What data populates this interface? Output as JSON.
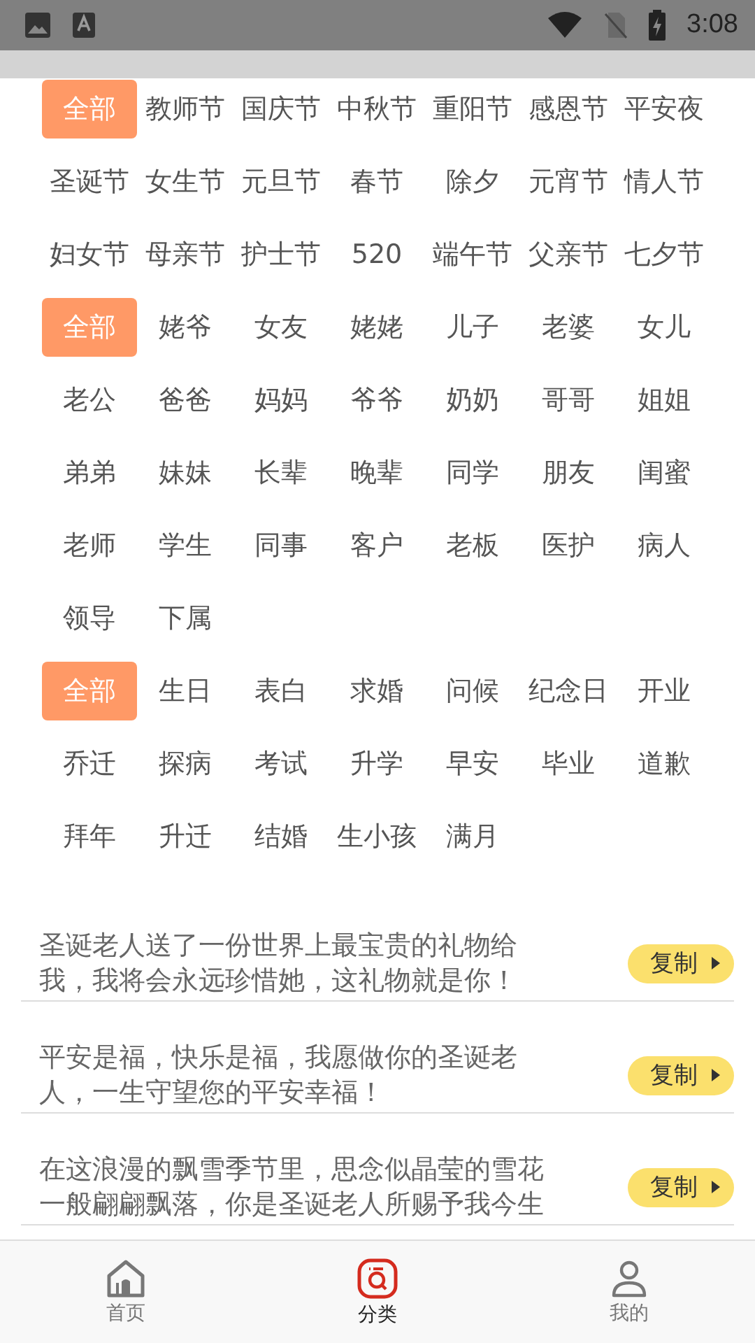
{
  "status_bar": {
    "time": "3:08"
  },
  "tag_groups": [
    {
      "tags": [
        {
          "label": "全部",
          "selected": true
        },
        {
          "label": "教师节",
          "selected": false
        },
        {
          "label": "国庆节",
          "selected": false
        },
        {
          "label": "中秋节",
          "selected": false
        },
        {
          "label": "重阳节",
          "selected": false
        },
        {
          "label": "感恩节",
          "selected": false
        },
        {
          "label": "平安夜",
          "selected": false
        },
        {
          "label": "圣诞节",
          "selected": false
        },
        {
          "label": "女生节",
          "selected": false
        },
        {
          "label": "元旦节",
          "selected": false
        },
        {
          "label": "春节",
          "selected": false
        },
        {
          "label": "除夕",
          "selected": false
        },
        {
          "label": "元宵节",
          "selected": false
        },
        {
          "label": "情人节",
          "selected": false
        },
        {
          "label": "妇女节",
          "selected": false
        },
        {
          "label": "母亲节",
          "selected": false
        },
        {
          "label": "护士节",
          "selected": false
        },
        {
          "label": "520",
          "selected": false
        },
        {
          "label": "端午节",
          "selected": false
        },
        {
          "label": "父亲节",
          "selected": false
        },
        {
          "label": "七夕节",
          "selected": false
        }
      ]
    },
    {
      "tags": [
        {
          "label": "全部",
          "selected": true
        },
        {
          "label": "姥爷",
          "selected": false
        },
        {
          "label": "女友",
          "selected": false
        },
        {
          "label": "姥姥",
          "selected": false
        },
        {
          "label": "儿子",
          "selected": false
        },
        {
          "label": "老婆",
          "selected": false
        },
        {
          "label": "女儿",
          "selected": false
        },
        {
          "label": "老公",
          "selected": false
        },
        {
          "label": "爸爸",
          "selected": false
        },
        {
          "label": "妈妈",
          "selected": false
        },
        {
          "label": "爷爷",
          "selected": false
        },
        {
          "label": "奶奶",
          "selected": false
        },
        {
          "label": "哥哥",
          "selected": false
        },
        {
          "label": "姐姐",
          "selected": false
        },
        {
          "label": "弟弟",
          "selected": false
        },
        {
          "label": "妹妹",
          "selected": false
        },
        {
          "label": "长辈",
          "selected": false
        },
        {
          "label": "晚辈",
          "selected": false
        },
        {
          "label": "同学",
          "selected": false
        },
        {
          "label": "朋友",
          "selected": false
        },
        {
          "label": "闺蜜",
          "selected": false
        },
        {
          "label": "老师",
          "selected": false
        },
        {
          "label": "学生",
          "selected": false
        },
        {
          "label": "同事",
          "selected": false
        },
        {
          "label": "客户",
          "selected": false
        },
        {
          "label": "老板",
          "selected": false
        },
        {
          "label": "医护",
          "selected": false
        },
        {
          "label": "病人",
          "selected": false
        },
        {
          "label": "领导",
          "selected": false
        },
        {
          "label": "下属",
          "selected": false
        }
      ]
    },
    {
      "tags": [
        {
          "label": "全部",
          "selected": true
        },
        {
          "label": "生日",
          "selected": false
        },
        {
          "label": "表白",
          "selected": false
        },
        {
          "label": "求婚",
          "selected": false
        },
        {
          "label": "问候",
          "selected": false
        },
        {
          "label": "纪念日",
          "selected": false
        },
        {
          "label": "开业",
          "selected": false
        },
        {
          "label": "乔迁",
          "selected": false
        },
        {
          "label": "探病",
          "selected": false
        },
        {
          "label": "考试",
          "selected": false
        },
        {
          "label": "升学",
          "selected": false
        },
        {
          "label": "早安",
          "selected": false
        },
        {
          "label": "毕业",
          "selected": false
        },
        {
          "label": "道歉",
          "selected": false
        },
        {
          "label": "拜年",
          "selected": false
        },
        {
          "label": "升迁",
          "selected": false
        },
        {
          "label": "结婚",
          "selected": false
        },
        {
          "label": "生小孩",
          "selected": false
        },
        {
          "label": "满月",
          "selected": false
        }
      ]
    }
  ],
  "messages": [
    {
      "lines": [
        "圣诞老人送了一份世界上最宝贵的礼物给",
        "我，我将会永远珍惜她，这礼物就是你！"
      ],
      "action": "复制"
    },
    {
      "lines": [
        "平安是福，快乐是福，我愿做你的圣诞老",
        "人，一生守望您的平安幸福！"
      ],
      "action": "复制"
    },
    {
      "lines": [
        "在这浪漫的飘雪季节里，思念似晶莹的雪花",
        "一般翩翩飘落，你是圣诞老人所赐予我今生"
      ],
      "action": "复制"
    }
  ],
  "nav": [
    {
      "label": "首页",
      "kind": "home",
      "selected": false
    },
    {
      "label": "分类",
      "kind": "category",
      "selected": true
    },
    {
      "label": "我的",
      "kind": "profile",
      "selected": false
    }
  ]
}
